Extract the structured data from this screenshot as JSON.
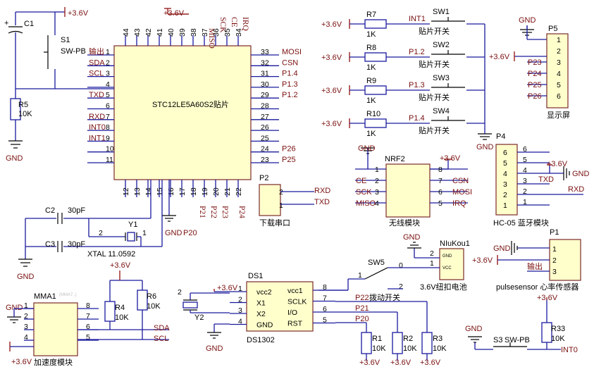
{
  "mcu": {
    "designator": "STC12LE5A60S2贴片",
    "power_net": "+3.6V",
    "top_pins": [
      "44",
      "43",
      "42",
      "41",
      "40",
      "39",
      "38",
      "37",
      "36",
      "35",
      "34"
    ],
    "top_labels": [
      "MISO",
      "SCK",
      "CE",
      "IRQ"
    ],
    "left_pins": [
      "1",
      "2",
      "3",
      "4",
      "5",
      "6",
      "7",
      "8",
      "9",
      "10",
      "11"
    ],
    "left_labels": [
      "输出",
      "SDA",
      "SCL",
      "",
      "TXD",
      "",
      "RXD",
      "INT0",
      "INT1",
      "",
      ""
    ],
    "right_pins": [
      "33",
      "32",
      "31",
      "30",
      "29",
      "28",
      "27",
      "26",
      "25",
      "24",
      "23"
    ],
    "right_labels": [
      "MOSI",
      "CSN",
      "P1.4",
      "P1.3",
      "P1.2",
      "",
      "",
      "",
      "",
      "P26",
      "P25"
    ],
    "bottom_pins": [
      "12",
      "13",
      "14",
      "15",
      "16",
      "17",
      "18",
      "19",
      "20",
      "21",
      "22"
    ],
    "bottom_labels": [
      "P20",
      "P21",
      "P22",
      "P23",
      "P24"
    ],
    "gnd_label": "GND"
  },
  "reset": {
    "cap": "C1",
    "switch": "S1",
    "switch_type": "SW-PB",
    "resistor": "R5",
    "resistor_value": "10K",
    "vcc": "+3.6V",
    "gnd": "GND"
  },
  "crystal": {
    "c2": "C2",
    "c2_value": "30pF",
    "c3": "C3",
    "c3_value": "30pF",
    "y1": "Y1",
    "y1_value": "XTAL 11.0592",
    "pin_a": "1",
    "pin_b": "2",
    "gnd": "GND"
  },
  "buttons": {
    "vcc": "+3.6V",
    "rows": [
      {
        "res": "R7",
        "val": "1K",
        "net": "INT1",
        "sw": "SW1",
        "type": "贴片开关"
      },
      {
        "res": "R8",
        "val": "1K",
        "net": "P1.2",
        "sw": "SW2",
        "type": "贴片开关"
      },
      {
        "res": "R9",
        "val": "1K",
        "net": "P1.3",
        "sw": "SW3",
        "type": "贴片开关"
      },
      {
        "res": "R10",
        "val": "1K",
        "net": "P1.4",
        "sw": "SW4",
        "type": "贴片开关"
      }
    ],
    "gnd": "GND"
  },
  "display": {
    "designator": "P5",
    "caption": "显示屏",
    "gnd": "GND",
    "vcc": "+3.6V",
    "pins": [
      "1",
      "2",
      "3",
      "4",
      "5",
      "6"
    ],
    "nets": [
      "GND",
      "+3.6V",
      "P23",
      "P24",
      "P25",
      "P26"
    ]
  },
  "bluetooth": {
    "designator": "P4",
    "caption": "HC-05 蓝牙模块",
    "inner_pins": [
      "6",
      "5",
      "4",
      "3",
      "2",
      "1"
    ],
    "outer_pins": [
      "6",
      "5",
      "4",
      "3",
      "2",
      "1"
    ],
    "vcc": "+3.6V",
    "gnd": "GND",
    "txd": "TXD",
    "rxd": "RXD"
  },
  "serial": {
    "designator": "P2",
    "caption": "下载串口",
    "pins": [
      "2",
      "1"
    ],
    "nets": [
      "RXD",
      "TXD"
    ]
  },
  "nrf": {
    "designator": "NRF2",
    "caption": "无线模块",
    "gnd": "GND",
    "vcc": "+3.6V",
    "left_pins": [
      "1",
      "2",
      "3",
      "4"
    ],
    "right_pins": [
      "8",
      "7",
      "6",
      "5"
    ],
    "left_nets": [
      "",
      "CE",
      "SCK",
      "MISO"
    ],
    "right_nets": [
      "",
      "CSN",
      "MOSI",
      "IRQ"
    ]
  },
  "battery": {
    "designator": "NIuKou1",
    "caption": "3.6V纽扣电池",
    "gnd": "GND",
    "pin1": "1",
    "pin2": "2",
    "pin1_name": "VCC",
    "pin2_name": "GND"
  },
  "toggle": {
    "designator": "SW5",
    "caption": "拨动开关",
    "pins": [
      "1",
      "0",
      "2"
    ],
    "net": "P22"
  },
  "pulse": {
    "designator": "P1",
    "caption": "pulsesensor 心率传感器",
    "gnd": "GND",
    "vcc": "+3.6V",
    "out": "输出",
    "pins": [
      "1",
      "2",
      "3"
    ]
  },
  "accel": {
    "designator": "MMA1",
    "ghost_label": "(MMA7..)",
    "caption": "加速度模块",
    "gnd": "GND",
    "vcc": "+3.6V",
    "left_pins": [
      "1",
      "2",
      "3",
      "4"
    ],
    "right_pins": [
      "8",
      "7",
      "6",
      "5"
    ],
    "r4": "R4",
    "r4_value": "10K",
    "r6": "R6",
    "r6_value": "10K",
    "sda": "SDA",
    "scl": "SCL",
    "pull_vcc": "+3.6V"
  },
  "rtc": {
    "designator": "DS1",
    "part": "DS1302",
    "vcc": "+3.6V",
    "gnd": "GND",
    "y2": "Y2",
    "y2_pin": "2",
    "left_pins": [
      "1",
      "2",
      "3",
      "4"
    ],
    "left_names": [
      "vcc2",
      "X1",
      "X2",
      "GND"
    ],
    "right_pins": [
      "8",
      "7",
      "6",
      "5"
    ],
    "right_names": [
      "vcc1",
      "SCLK",
      "I/O",
      "RST"
    ],
    "nets": [
      "P22",
      "P21",
      "P20"
    ],
    "pullups": [
      {
        "res": "R1",
        "val": "10K",
        "vcc": "+3.6V"
      },
      {
        "res": "R2",
        "val": "10K",
        "vcc": "+3.6V"
      },
      {
        "res": "R3",
        "val": "10K",
        "vcc": "+3.6V"
      }
    ]
  },
  "int0": {
    "switch": "S3",
    "switch_type": "SW-PB",
    "gnd": "GND",
    "resistor": "R33",
    "resistor_value": "10K",
    "vcc": "+3.6V",
    "net": "INT0"
  }
}
